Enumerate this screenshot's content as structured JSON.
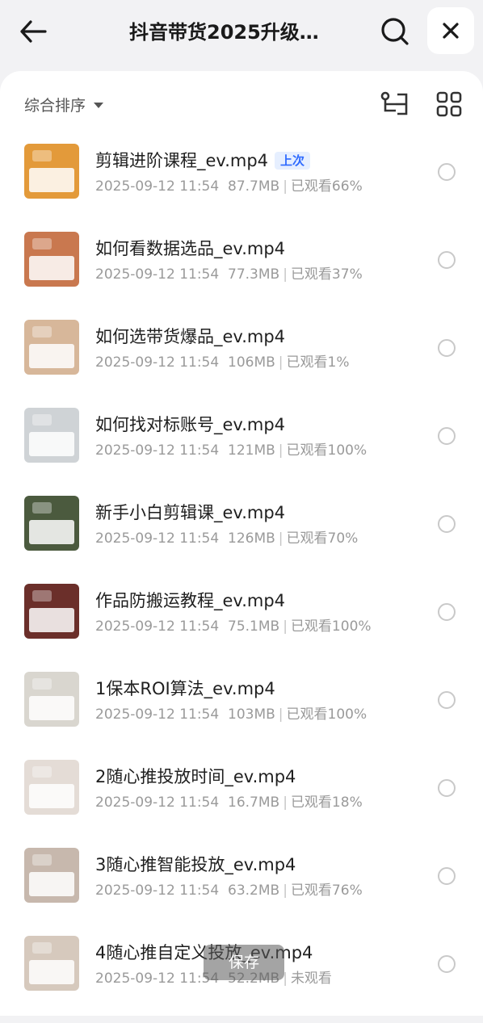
{
  "header": {
    "title": "抖音带货2025升级…",
    "back_icon": "arrow-left-icon",
    "search_icon": "search-icon",
    "close_icon": "close-icon"
  },
  "toolbar": {
    "sort_label": "综合排序",
    "sort_icon": "caret-down-icon",
    "tree_icon": "tree-view-icon",
    "grid_icon": "grid-view-icon"
  },
  "files": [
    {
      "name": "剪辑进阶课程_ev.mp4",
      "badge": "上次",
      "date": "2025-09-12 11:54",
      "size": "87.7MB",
      "status": "已观看66%",
      "thumb_color": "#e39a3a"
    },
    {
      "name": "如何看数据选品_ev.mp4",
      "badge": "",
      "date": "2025-09-12 11:54",
      "size": "77.3MB",
      "status": "已观看37%",
      "thumb_color": "#c9784f"
    },
    {
      "name": "如何选带货爆品_ev.mp4",
      "badge": "",
      "date": "2025-09-12 11:54",
      "size": "106MB",
      "status": "已观看1%",
      "thumb_color": "#d7b79a"
    },
    {
      "name": "如何找对标账号_ev.mp4",
      "badge": "",
      "date": "2025-09-12 11:54",
      "size": "121MB",
      "status": "已观看100%",
      "thumb_color": "#cfd3d6"
    },
    {
      "name": "新手小白剪辑课_ev.mp4",
      "badge": "",
      "date": "2025-09-12 11:54",
      "size": "126MB",
      "status": "已观看70%",
      "thumb_color": "#4b5a3e"
    },
    {
      "name": "作品防搬运教程_ev.mp4",
      "badge": "",
      "date": "2025-09-12 11:54",
      "size": "75.1MB",
      "status": "已观看100%",
      "thumb_color": "#6b2f2a"
    },
    {
      "name": "1保本ROI算法_ev.mp4",
      "badge": "",
      "date": "2025-09-12 11:54",
      "size": "103MB",
      "status": "已观看100%",
      "thumb_color": "#d9d6cf"
    },
    {
      "name": "2随心推投放时间_ev.mp4",
      "badge": "",
      "date": "2025-09-12 11:54",
      "size": "16.7MB",
      "status": "已观看18%",
      "thumb_color": "#e4dcd6"
    },
    {
      "name": "3随心推智能投放_ev.mp4",
      "badge": "",
      "date": "2025-09-12 11:54",
      "size": "63.2MB",
      "status": "已观看76%",
      "thumb_color": "#c7b8ad"
    },
    {
      "name": "4随心推自定义投放_ev.mp4",
      "badge": "",
      "date": "2025-09-12 11:54",
      "size": "52.2MB",
      "status": "未观看",
      "thumb_color": "#d6c9bd"
    }
  ],
  "save_label": "保存",
  "colors": {
    "accent": "#2f6bff",
    "meta_text": "#9a9a9a",
    "background": "#f2f2f4"
  }
}
